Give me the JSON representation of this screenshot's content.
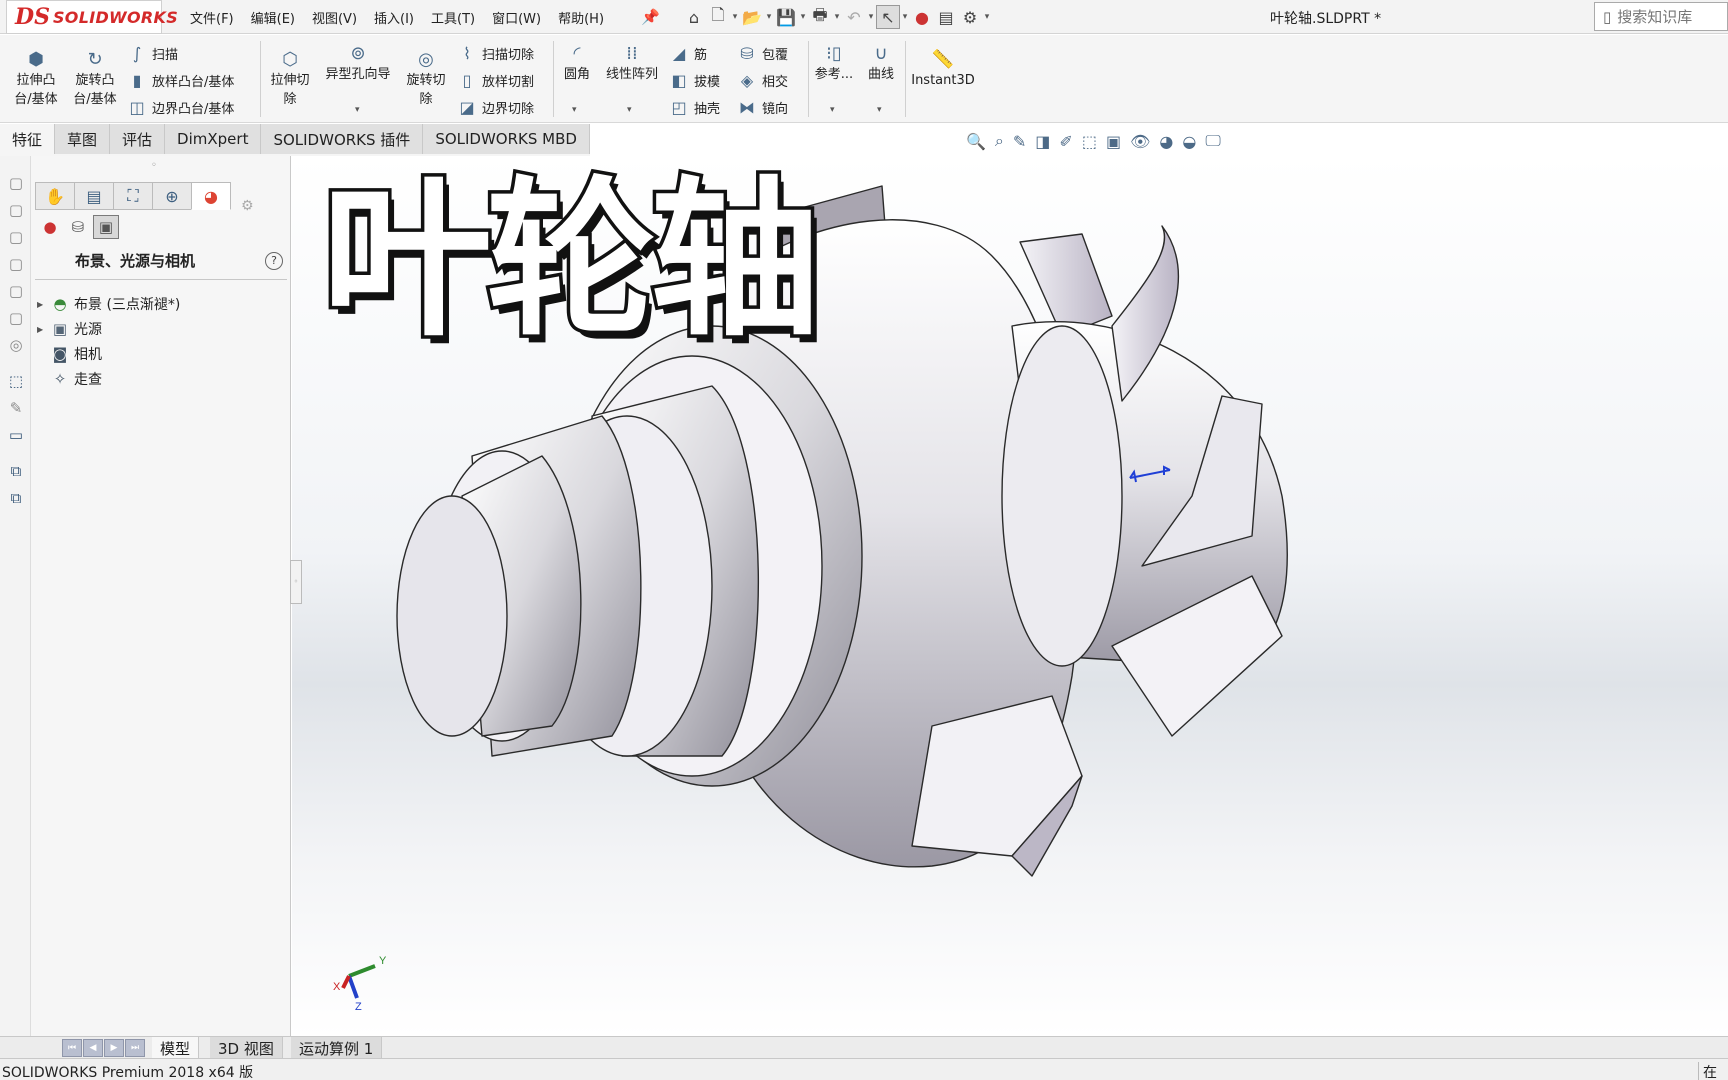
{
  "app": {
    "logo_ds": "DS",
    "logo_text": "SOLIDWORKS",
    "document_title": "叶轮轴.SLDPRT *",
    "search_placeholder": "搜索知识库"
  },
  "menus": [
    "文件(F)",
    "编辑(E)",
    "视图(V)",
    "插入(I)",
    "工具(T)",
    "窗口(W)",
    "帮助(H)"
  ],
  "quick_access": [
    "home-icon",
    "new-document-icon",
    "open-icon",
    "save-icon",
    "print-icon",
    "undo-icon",
    "select-icon",
    "rebuild-icon",
    "file-properties-icon",
    "options-icon"
  ],
  "command_manager": {
    "extrude_boss": "拉伸凸\n台/基体",
    "revolve_boss": "旋转凸\n台/基体",
    "sweep": "扫描",
    "loft_boss": "放样凸台/基体",
    "boundary_boss": "边界凸台/基体",
    "extrude_cut": "拉伸切\n除",
    "hole_wizard": "异型孔向导",
    "revolve_cut": "旋转切\n除",
    "swept_cut": "扫描切除",
    "lofted_cut": "放样切割",
    "boundary_cut": "边界切除",
    "fillet": "圆角",
    "linear_pattern": "线性阵列",
    "rib": "筋",
    "draft": "拔模",
    "shell": "抽壳",
    "wrap": "包覆",
    "intersect": "相交",
    "mirror": "镜向",
    "reference": "参考...",
    "curves": "曲线",
    "instant3d": "Instant3D"
  },
  "tabs": [
    "特征",
    "草图",
    "评估",
    "DimXpert",
    "SOLIDWORKS 插件",
    "SOLIDWORKS MBD"
  ],
  "active_tab": "特征",
  "panel": {
    "title": "布景、光源与相机",
    "tree": [
      {
        "label": "布景 (三点渐褪*)",
        "icon": "scene-icon",
        "expandable": true
      },
      {
        "label": "光源",
        "icon": "lights-icon",
        "expandable": true
      },
      {
        "label": "相机",
        "icon": "camera-icon",
        "expandable": false
      },
      {
        "label": "走查",
        "icon": "walkthrough-icon",
        "expandable": false
      }
    ]
  },
  "viewport": {
    "overlay_title": "叶轮轴",
    "triad_labels": {
      "x": "X",
      "y": "Y",
      "z": "Z"
    }
  },
  "bottom_tabs": [
    "模型",
    "3D 视图",
    "运动算例 1"
  ],
  "active_bottom_tab": "模型",
  "status": {
    "left": "SOLIDWORKS Premium 2018 x64 版",
    "right": "在编"
  },
  "colors": {
    "brand_red": "#d42a2a",
    "icon_blue": "#4a6b8a"
  }
}
